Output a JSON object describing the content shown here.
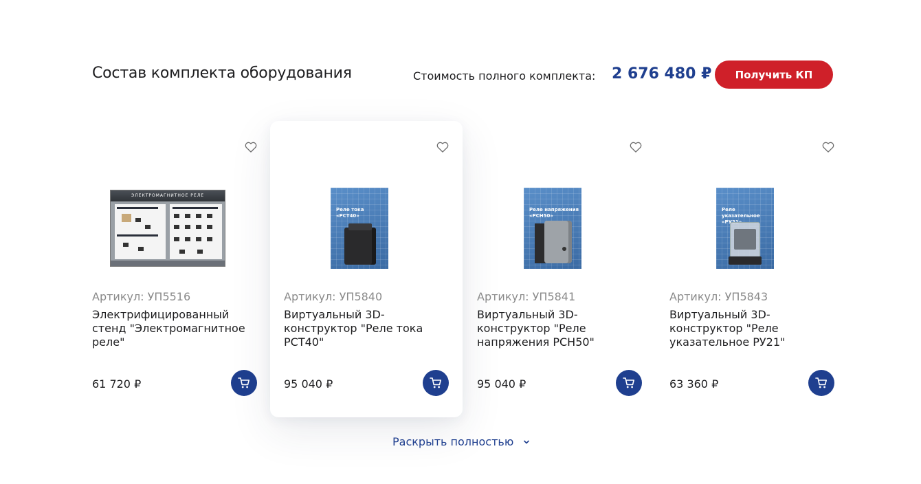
{
  "section": {
    "title": "Состав комплекта оборудования",
    "cost_label": "Стоимость полного комплекта:",
    "cost_value": "2 676 480 ₽",
    "cta_label": "Получить КП"
  },
  "products": [
    {
      "sku": "Артикул: УП5516",
      "name": "Электрифицированный стенд \"Электромагнитное реле\"",
      "price": "61 720 ₽",
      "image_text": "ЭЛЕКТРОМАГНИТНОЕ РЕЛЕ"
    },
    {
      "sku": "Артикул: УП5840",
      "name": "Виртуальный 3D-конструктор \"Реле тока РСТ40\"",
      "price": "95 040 ₽",
      "image_text": "Реле тока «РСТ40»"
    },
    {
      "sku": "Артикул: УП5841",
      "name": "Виртуальный 3D-конструктор \"Реле напряжения РСН50\"",
      "price": "95 040 ₽",
      "image_text": "Реле напряжения «РСН50»"
    },
    {
      "sku": "Артикул: УП5843",
      "name": "Виртуальный 3D-конструктор \"Реле указательное РУ21\"",
      "price": "63 360 ₽",
      "image_text": "Реле указательное «РУ21»"
    }
  ],
  "expand_label": "Раскрыть полностью",
  "icons": {
    "favorite": "heart-icon",
    "cart": "cart-icon",
    "expand": "chevron-down-icon"
  },
  "colors": {
    "accent_blue": "#1f3f8f",
    "accent_red": "#cf2029"
  }
}
